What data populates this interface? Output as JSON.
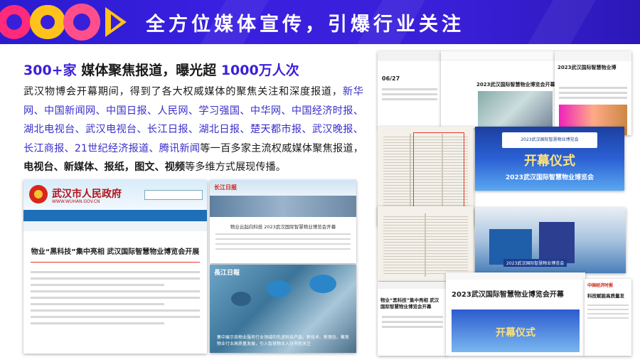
{
  "banner": {
    "title": "全方位媒体宣传，引爆行业关注",
    "colors": {
      "primary": "#3a1fd8",
      "accent_pink": "#ff2b7a",
      "accent_yellow": "#ffc21a"
    }
  },
  "headline": {
    "count": "300+家",
    "middle": " 媒体聚焦报道，曝光超 ",
    "reach": "1000万人次"
  },
  "body": {
    "intro": "武汉物博会开幕期间，得到了各大权威媒体的聚焦关注和深度报道，",
    "media_list": "新华网、中国新闻网、中国日报、人民网、学习强国、中华网、中国经济时报、湖北电视台、武汉电视台、长江日报、湖北日报、楚天都市报、武汉晚报、长江商报、21世纪经济报道、腾讯新闻",
    "middle": "等一百多家主流权威媒体聚焦报道，",
    "forms": "电视台、新媒体、报纸，图文、视频",
    "tail": "等多维方式展现传播。"
  },
  "screenshots": {
    "gov": {
      "site_name": "武汉市人民政府",
      "site_url": "WWW.WUHAN.GOV.CN",
      "article_title": "物业“黑科技”集中亮相 武汉国际智慧物业博览会开展"
    },
    "news": {
      "paper_name": "长江日报",
      "article_title": "物业云起向科技 2023武汉国际智慧物业博览会开幕"
    },
    "photo": {
      "paper_name": "長江日報",
      "caption": "集中展示各物业服务行业领域的先进科技产品、新技术、新理念，聚焦物业行业高质量发展，引入智慧物业入驻市民关注"
    },
    "right": {
      "expo_banner_1": "2023武汉国际智慧物业博览会",
      "expo_stage_1": "开幕仪式",
      "expo_stage_2": "2023武汉国际智慧物业博览会",
      "article_top": "2023武汉国际智慧物业博览会开幕",
      "article_top_right": "2023武汉国际智慧物业博",
      "paper_name_right": "中国经济时报",
      "article_bottom": "2023武汉国际智慧物业博览会开幕",
      "article_bottom_left": "物业“黑科技”集中亮相 武汉国际智慧物业博览会开幕",
      "article_bottom_right": "科技赋能高质量发",
      "stage_bottom": "开幕仪式",
      "expo_date": "06/27",
      "booth_banner": "2023武汉国际智慧物业博览会"
    }
  }
}
